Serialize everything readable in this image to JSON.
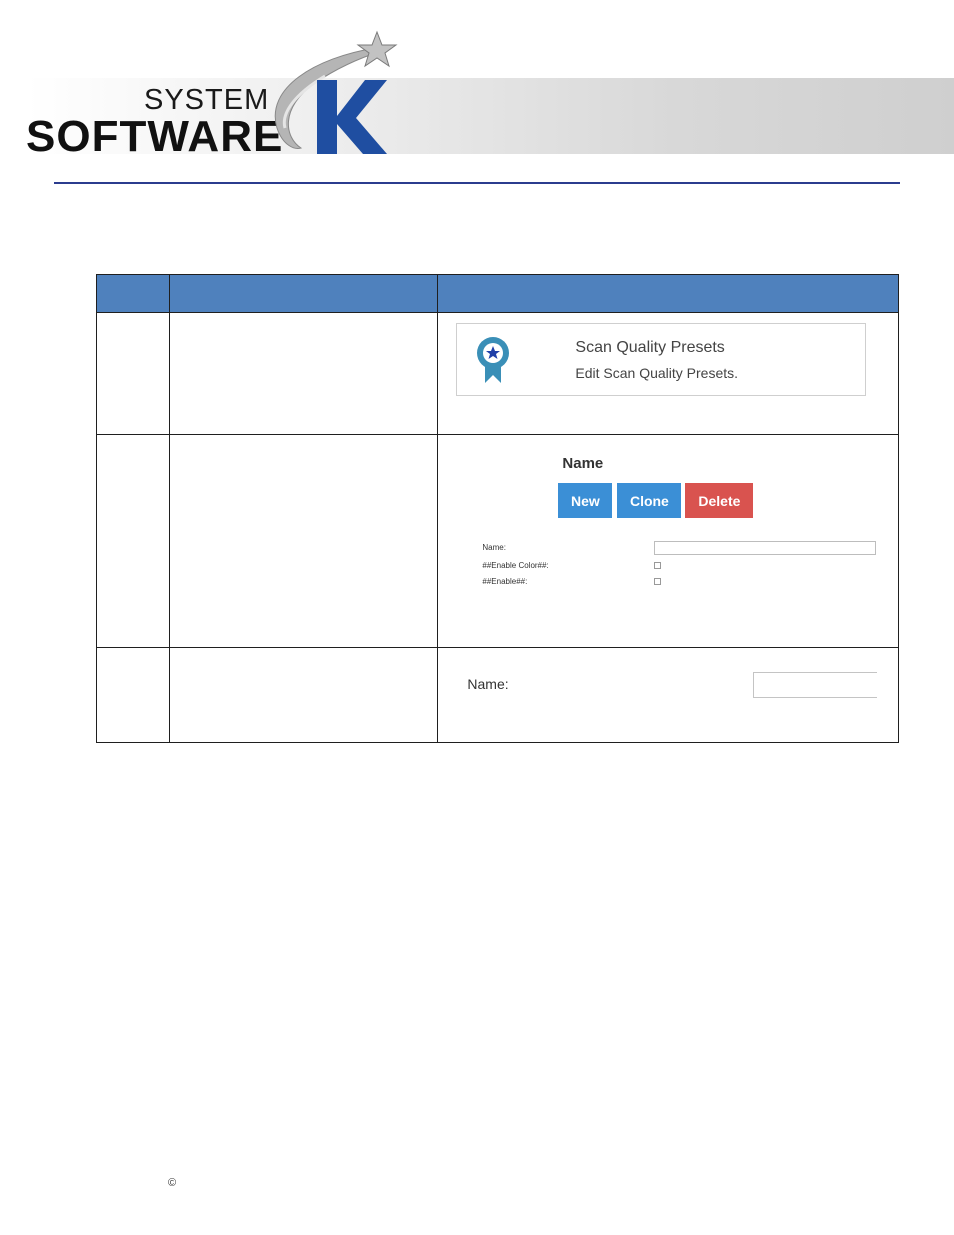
{
  "logo": {
    "line1": "SYSTEM",
    "line2": "SOFTWARE",
    "mark": "K",
    "colors": {
      "k_blue": "#1f4ea1",
      "swoosh_gray": "#a9a9a9",
      "rule": "#2b3c8e"
    }
  },
  "table": {
    "header_color": "#4f81bd",
    "rows": [
      {
        "tile": {
          "icon": "award-ribbon-icon",
          "title": "Scan Quality Presets",
          "subtitle": "Edit Scan Quality Presets."
        }
      },
      {
        "form": {
          "heading": "Name",
          "buttons": {
            "new": "New",
            "clone": "Clone",
            "delete": "Delete"
          },
          "fields": {
            "name_label": "Name:",
            "enable_color_label": "##Enable Color##:",
            "enable_label": "##Enable##:"
          },
          "colors": {
            "primary": "#3b8fd6",
            "danger": "#d9534f"
          }
        }
      },
      {
        "field": {
          "label": "Name:",
          "value": ""
        }
      }
    ]
  },
  "footer": {
    "copyright": "©"
  }
}
